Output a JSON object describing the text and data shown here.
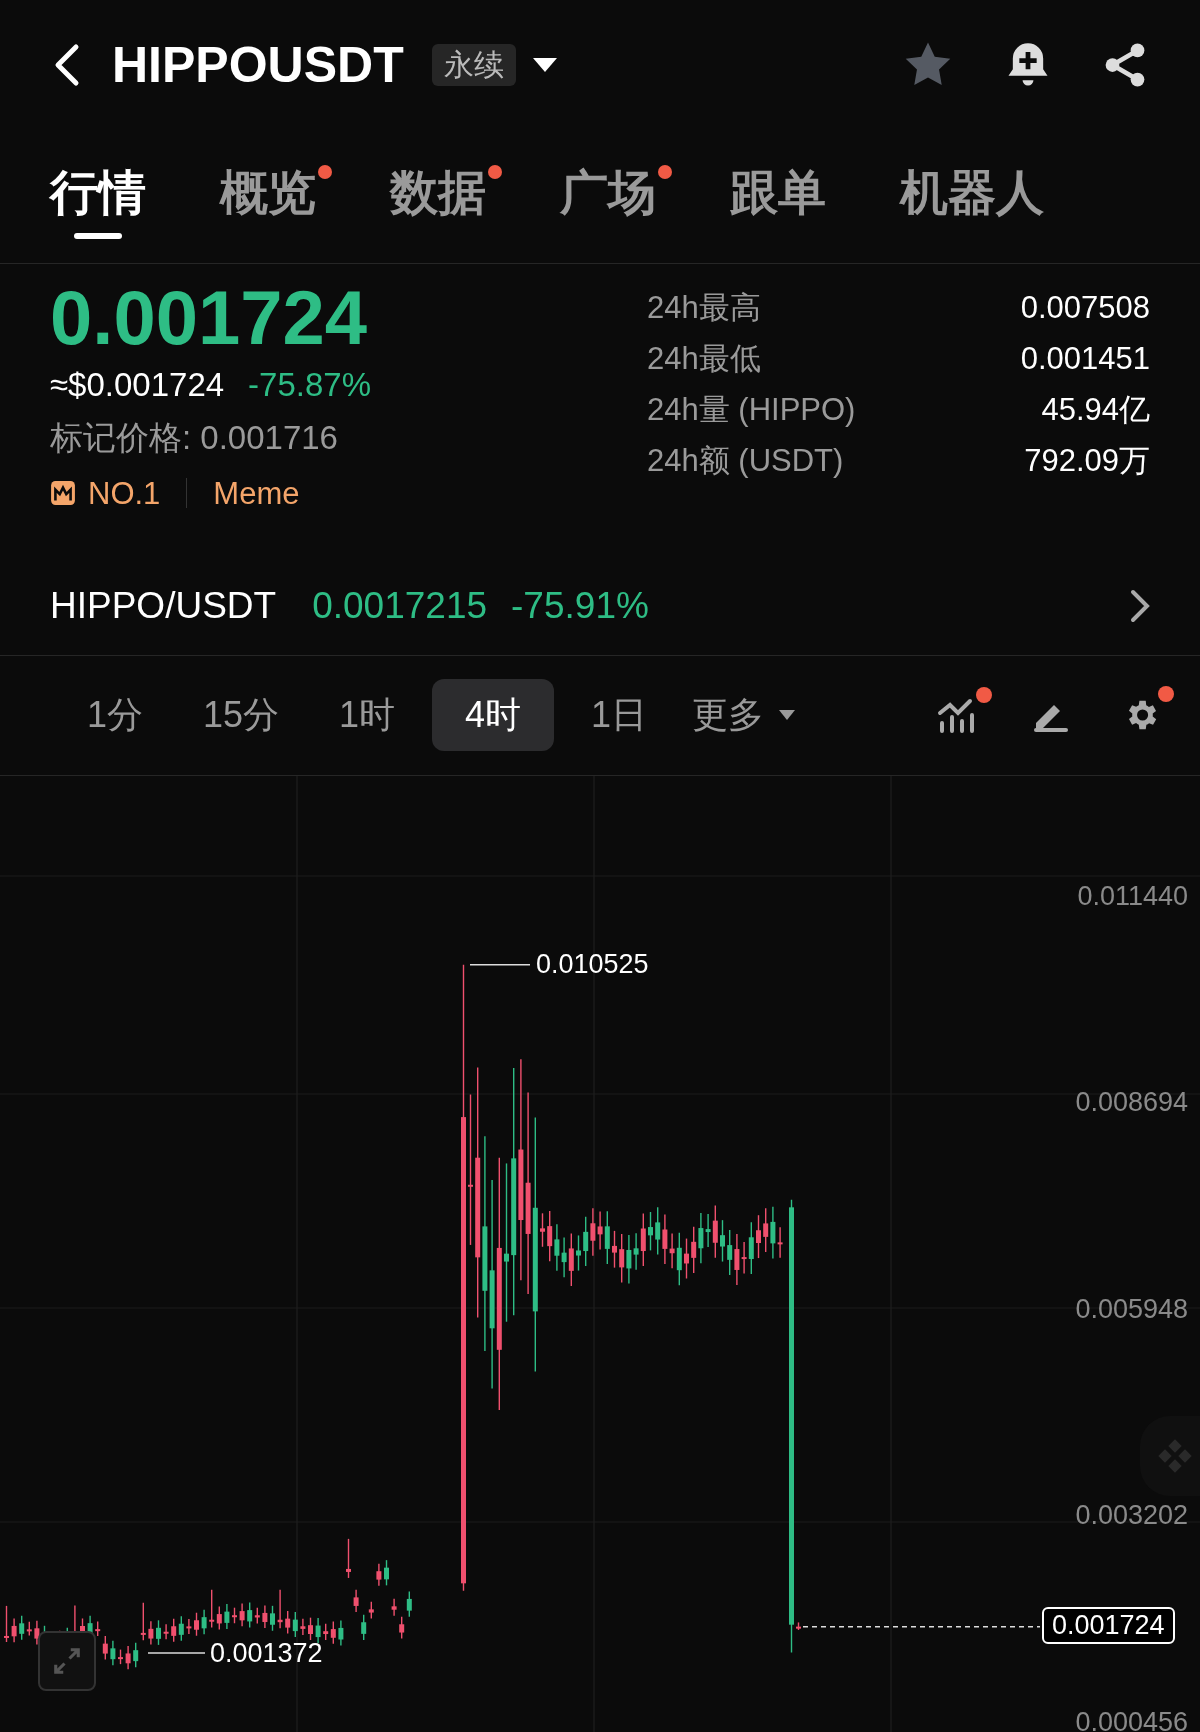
{
  "header": {
    "title": "HIPPOUSDT",
    "badge": "永续"
  },
  "tabs": [
    {
      "label": "行情",
      "selected": true,
      "dot": false
    },
    {
      "label": "概览",
      "selected": false,
      "dot": true
    },
    {
      "label": "数据",
      "selected": false,
      "dot": true
    },
    {
      "label": "广场",
      "selected": false,
      "dot": true
    },
    {
      "label": "跟单",
      "selected": false,
      "dot": false
    },
    {
      "label": "机器人",
      "selected": false,
      "dot": false
    }
  ],
  "price": {
    "last": "0.001724",
    "usd": "≈$0.001724",
    "change": "-75.87%",
    "mark": "标记价格: 0.001716",
    "rank": "NO.1",
    "tag": "Meme"
  },
  "stats": [
    {
      "label": "24h最高",
      "value": "0.007508"
    },
    {
      "label": "24h最低",
      "value": "0.001451"
    },
    {
      "label": "24h量 (HIPPO)",
      "value": "45.94亿"
    },
    {
      "label": "24h额 (USDT)",
      "value": "792.09万"
    }
  ],
  "spot": {
    "pair": "HIPPO/USDT",
    "price": "0.0017215",
    "change": "-75.91%"
  },
  "intervals": [
    {
      "label": "1分",
      "selected": false
    },
    {
      "label": "15分",
      "selected": false
    },
    {
      "label": "1时",
      "selected": false
    },
    {
      "label": "4时",
      "selected": true
    },
    {
      "label": "1日",
      "selected": false
    }
  ],
  "more": "更多",
  "tools": [
    {
      "kind": "indicator",
      "dot": true
    },
    {
      "kind": "draw",
      "dot": false
    },
    {
      "kind": "settings",
      "dot": true
    }
  ],
  "chart": {
    "y_labels": [
      "0.011440",
      "0.008694",
      "0.005948",
      "0.003202",
      "0.000456"
    ],
    "high": "0.010525",
    "low": "0.001372",
    "last": "0.001724"
  }
}
